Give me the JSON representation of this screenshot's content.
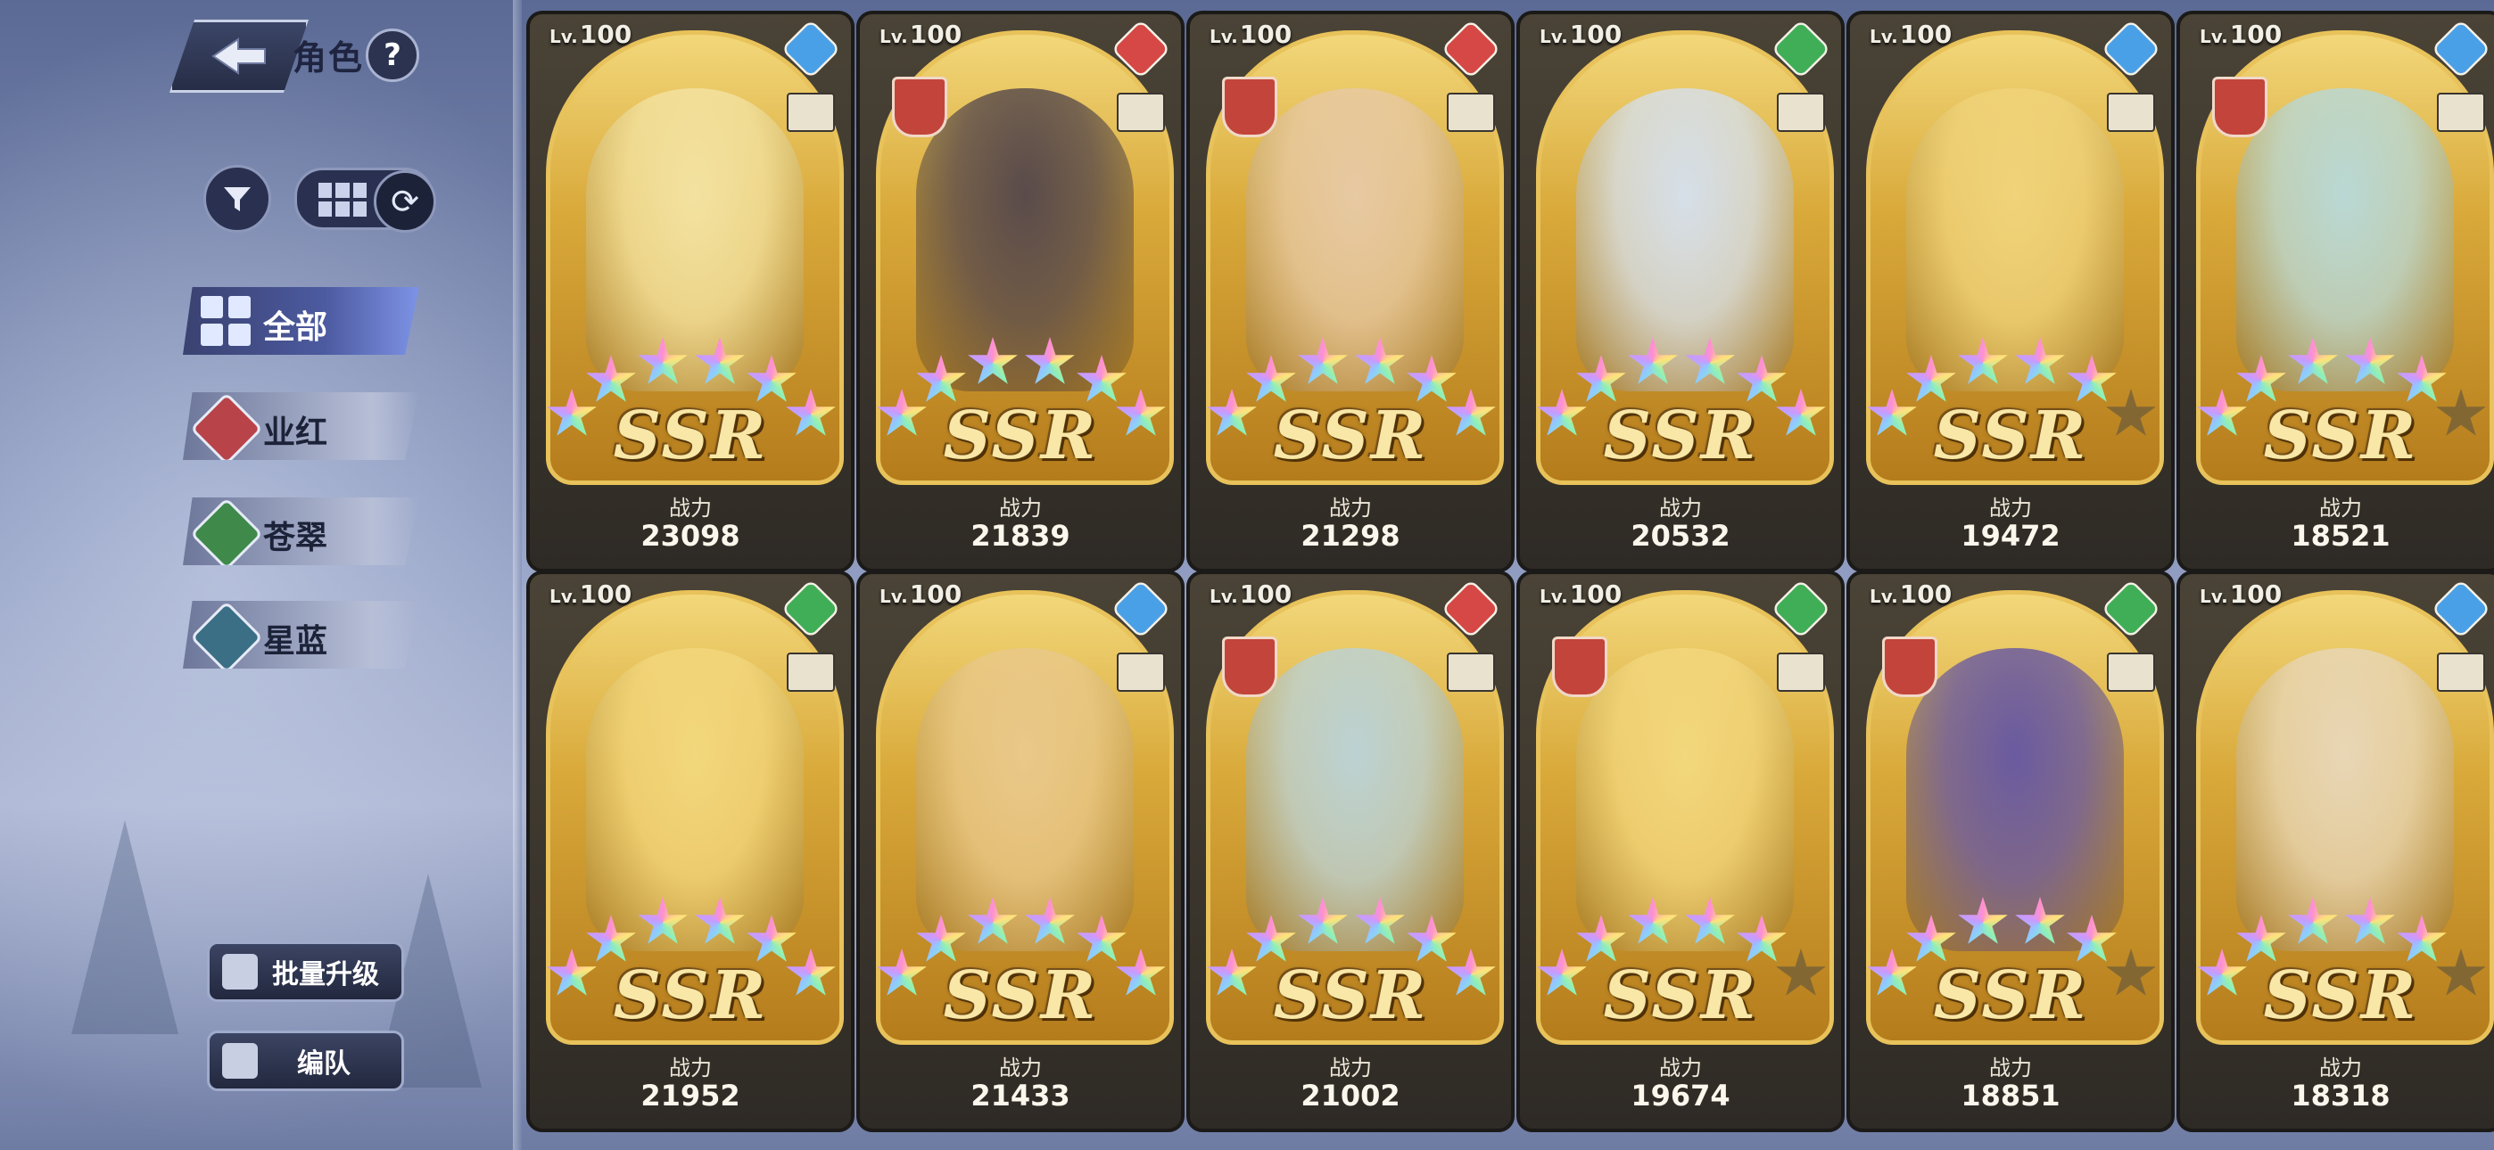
{
  "header": {
    "title": "角色",
    "help_label": "?"
  },
  "toolbar": {
    "refresh_symbol": "⟳"
  },
  "categories": [
    {
      "label": "全部",
      "active": true,
      "color": "#4c5aa0"
    },
    {
      "label": "业红",
      "active": false,
      "color": "#b8444a"
    },
    {
      "label": "苍翠",
      "active": false,
      "color": "#3f8a4a"
    },
    {
      "label": "星蓝",
      "active": false,
      "color": "#3a6f86"
    }
  ],
  "bottom_buttons": {
    "batch_upgrade": "批量升级",
    "formation": "编队"
  },
  "card_common": {
    "level_prefix": "Lv.",
    "rarity": "SSR",
    "power_label": "战力"
  },
  "cards": [
    {
      "level": "100",
      "power": "23098",
      "element_color": "#4aa0e6",
      "element_icon": "staff-icon",
      "has_badge": false,
      "stars": 6,
      "tint": "#f3e2a0"
    },
    {
      "level": "100",
      "power": "21839",
      "element_color": "#d54845",
      "element_icon": "sword-icon",
      "has_badge": true,
      "stars": 6,
      "tint": "#5a4b4b"
    },
    {
      "level": "100",
      "power": "21298",
      "element_color": "#d54845",
      "element_icon": "flame-icon",
      "has_badge": true,
      "stars": 6,
      "tint": "#e7c9a2"
    },
    {
      "level": "100",
      "power": "20532",
      "element_color": "#3fae57",
      "element_icon": "shield-icon",
      "has_badge": false,
      "stars": 6,
      "tint": "#d6dfe9"
    },
    {
      "level": "100",
      "power": "19472",
      "element_color": "#4aa0e6",
      "element_icon": "sword-icon",
      "has_badge": false,
      "stars": 5,
      "tint": "#f0d37a"
    },
    {
      "level": "100",
      "power": "18521",
      "element_color": "#4aa0e6",
      "element_icon": "staff-icon",
      "has_badge": true,
      "stars": 5,
      "tint": "#b9d8d4"
    },
    {
      "level": "100",
      "power": "21952",
      "element_color": "#3fae57",
      "element_icon": "flame-icon",
      "has_badge": false,
      "stars": 6,
      "tint": "#f3d77c"
    },
    {
      "level": "100",
      "power": "21433",
      "element_color": "#4aa0e6",
      "element_icon": "flame-icon",
      "has_badge": false,
      "stars": 6,
      "tint": "#e9c889"
    },
    {
      "level": "100",
      "power": "21002",
      "element_color": "#d54845",
      "element_icon": "sword-icon",
      "has_badge": true,
      "stars": 6,
      "tint": "#bcd2d3"
    },
    {
      "level": "100",
      "power": "19674",
      "element_color": "#3fae57",
      "element_icon": "axe-icon",
      "has_badge": true,
      "stars": 5,
      "tint": "#f3d77c"
    },
    {
      "level": "100",
      "power": "18851",
      "element_color": "#3fae57",
      "element_icon": "flame-icon",
      "has_badge": true,
      "stars": 5,
      "tint": "#6a5aa0"
    },
    {
      "level": "100",
      "power": "18318",
      "element_color": "#4aa0e6",
      "element_icon": "axe-icon",
      "has_badge": false,
      "stars": 5,
      "tint": "#e8d6b5"
    }
  ]
}
